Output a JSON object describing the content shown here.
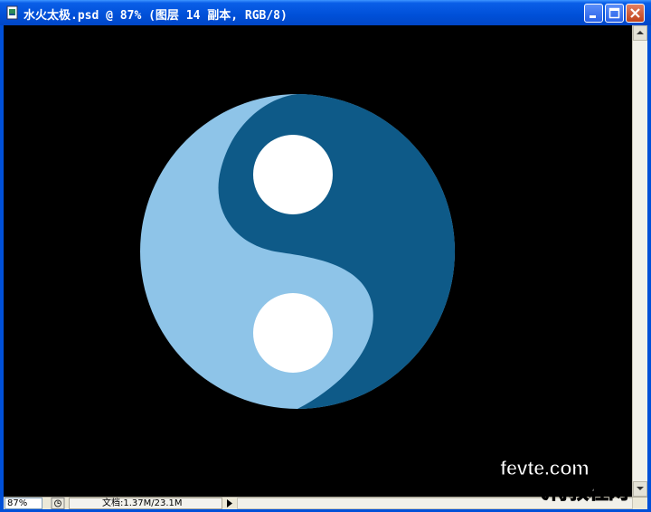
{
  "window": {
    "title": "水火太极.psd @ 87% (图层 14 副本, RGB/8)",
    "buttons": [
      "minimize",
      "maximize",
      "close"
    ]
  },
  "canvas": {
    "background": "#000000",
    "artwork": "yin-yang",
    "colors": {
      "dark": "#0e5a88",
      "light": "#8ec4e8",
      "dots": "#ffffff"
    }
  },
  "statusbar": {
    "zoom": "87%",
    "doc_info": "文档:1.37M/23.1M"
  },
  "watermark": {
    "line1": "fevte.com",
    "line2": "飞特教程网"
  }
}
